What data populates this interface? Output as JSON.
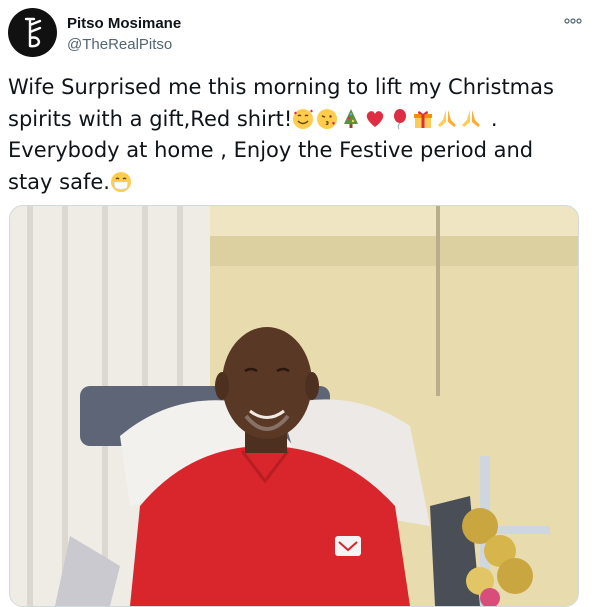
{
  "author": {
    "name": "Pitso Mosimane",
    "handle": "@TheRealPitso",
    "avatar_icon": "pitso-logo-icon"
  },
  "more_icon": "more-options-icon",
  "tweet": {
    "text_part1": "Wife Surprised me this morning to lift my Christmas spirits with a gift,Red shirt!",
    "emoji_sequence": [
      "smiling-hearts-emoji",
      "kiss-emoji",
      "christmas-tree-emoji",
      "red-heart-emoji",
      "balloon-emoji",
      "gift-emoji",
      "praying-hands-emoji",
      "praying-hands-emoji"
    ],
    "text_part2": " . Everybody at home , Enjoy the Festive period and stay safe.",
    "emoji_end": "face-with-mask-emoji"
  },
  "media": {
    "alt_subject": "man-in-red-shirt-hospital-bed-photo",
    "colors": {
      "wall": "#e8dcae",
      "curtain": "#efece6",
      "shirt": "#d8262c",
      "skin": "#5a3826",
      "tinsel": "#c9a640"
    }
  },
  "colors": {
    "text": "#0f1419",
    "secondary": "#536471",
    "border": "#cfd9de"
  }
}
